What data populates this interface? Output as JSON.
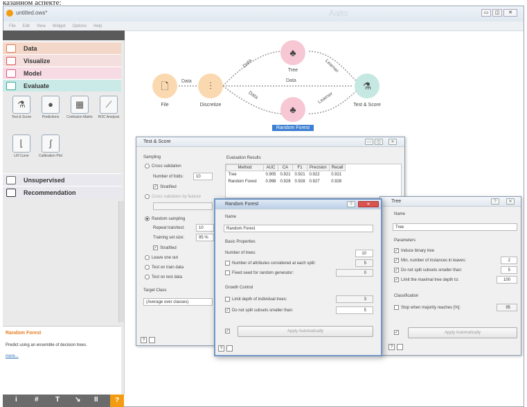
{
  "caption": "казанном аспекте:",
  "window": {
    "title": "untitled.ows*",
    "app_name": "Aalto"
  },
  "menu": [
    "File",
    "Edit",
    "View",
    "Widget",
    "Options",
    "Help"
  ],
  "sidebar": {
    "categories": [
      {
        "label": "Data",
        "icon": "table-icon"
      },
      {
        "label": "Visualize",
        "icon": "chart-icon"
      },
      {
        "label": "Model",
        "icon": "tree-icon"
      },
      {
        "label": "Evaluate",
        "icon": "grid-icon"
      },
      {
        "label": "Unsupervised",
        "icon": "clusters-icon"
      },
      {
        "label": "Recommendation",
        "icon": "star-icon"
      }
    ],
    "widgets": [
      {
        "label": "Test & Score",
        "icon": "flask-icon"
      },
      {
        "label": "Predictions",
        "icon": "crystal-ball-icon"
      },
      {
        "label": "Confusion Matrix",
        "icon": "matrix-icon"
      },
      {
        "label": "ROC Analysis",
        "icon": "roc-curve-icon"
      },
      {
        "label": "Lift Curve",
        "icon": "lift-curve-icon"
      },
      {
        "label": "Calibration Plot",
        "icon": "calibration-icon"
      }
    ],
    "desc_title": "Random Forest",
    "desc_text": "Predict using an ensemble of decision trees.",
    "desc_more": "more..."
  },
  "canvas": {
    "nodes": {
      "file": "File",
      "discretize": "Discretize",
      "tree": "Tree",
      "random_forest": "Random Forest",
      "test_score": "Test & Score"
    },
    "links": {
      "l1": "Data",
      "l2": "Data",
      "l3": "Data",
      "l4": "Data",
      "l5": "Learner",
      "l6": "Learner",
      "l7": "Data"
    }
  },
  "test_score": {
    "title": "Test & Score",
    "sampling": "Sampling",
    "cross_validation": "Cross validation",
    "folds_label": "Number of folds:",
    "folds_value": "10",
    "stratified": "Stratified",
    "cv_feature": "Cross validation by feature",
    "random_sampling": "Random sampling",
    "repeat_label": "Repeat train/test:",
    "repeat_value": "10",
    "train_size_label": "Training set size:",
    "train_size_value": "95 %",
    "stratified2": "Stratified",
    "leave_one_out": "Leave one out",
    "test_train": "Test on train data",
    "test_test": "Test on test data",
    "target_class": "Target Class",
    "target_value": "(Average over classes)",
    "results_title": "Evaluation Results",
    "columns": [
      "Method",
      "AUC",
      "CA",
      "F1",
      "Precision",
      "Recall"
    ],
    "rows": [
      [
        "Tree",
        "0.905",
        "0.921",
        "0.921",
        "0.922",
        "0.921"
      ],
      [
        "Random Forest",
        "0.998",
        "0.928",
        "0.928",
        "0.927",
        "0.928"
      ]
    ]
  },
  "random_forest": {
    "title": "Random Forest",
    "name_section": "Name",
    "name_value": "Random Forest",
    "basic": "Basic Properties",
    "n_trees_label": "Number of trees:",
    "n_trees_value": "10",
    "n_attr_label": "Number of attributes considered at each split:",
    "n_attr_value": "5",
    "fixed_seed_label": "Fixed seed for random generator:",
    "fixed_seed_value": "0",
    "growth": "Growth Control",
    "limit_depth_label": "Limit depth of individual trees:",
    "limit_depth_value": "3",
    "no_split_label": "Do not split subsets smaller than:",
    "no_split_value": "5",
    "apply": "Apply Automatically"
  },
  "tree": {
    "title": "Tree",
    "name_section": "Name",
    "name_value": "Tree",
    "parameters": "Parameters",
    "binary": "Induce binary tree",
    "min_inst_label": "Min. number of instances in leaves:",
    "min_inst_value": "2",
    "no_split_label": "Do not split subsets smaller than:",
    "no_split_value": "5",
    "max_depth_label": "Limit the maximal tree depth to:",
    "max_depth_value": "100",
    "classification": "Classification",
    "stop_label": "Stop when majority reaches [%]:",
    "stop_value": "95",
    "apply": "Apply Automatically"
  }
}
